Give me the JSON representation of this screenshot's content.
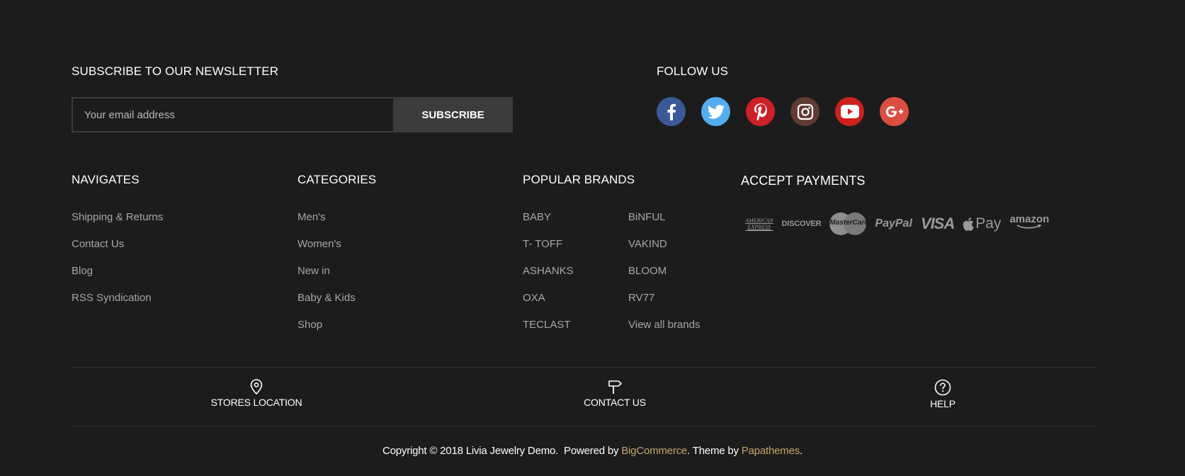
{
  "newsletter": {
    "heading": "SUBSCRIBE TO OUR NEWSLETTER",
    "placeholder": "Your email address",
    "button": "SUBSCRIBE"
  },
  "follow": {
    "heading": "FOLLOW US",
    "networks": [
      {
        "name": "facebook-icon",
        "color": "#3b5998"
      },
      {
        "name": "twitter-icon",
        "color": "#55acee"
      },
      {
        "name": "pinterest-icon",
        "color": "#cb2027"
      },
      {
        "name": "instagram-icon",
        "color": "#5f3b31"
      },
      {
        "name": "youtube-icon",
        "color": "#cd201f"
      },
      {
        "name": "google-plus-icon",
        "color": "#dc4e41"
      }
    ]
  },
  "navigates": {
    "heading": "NAVIGATES",
    "items": [
      "Shipping & Returns",
      "Contact Us",
      "Blog",
      "RSS Syndication"
    ]
  },
  "categories": {
    "heading": "CATEGORIES",
    "items": [
      "Men's",
      "Women's",
      "New in",
      "Baby & Kids",
      "Shop"
    ]
  },
  "brands": {
    "heading": "POPULAR BRANDS",
    "col1": [
      "BABY",
      "T- TOFF",
      "ASHANKS",
      "OXA",
      "TECLAST"
    ],
    "col2": [
      "BiNFUL",
      "VAKIND",
      "BLOOM",
      "RV77",
      "View all brands"
    ]
  },
  "payments": {
    "heading": "ACCEPT PAYMENTS",
    "methods": {
      "amex_line1": "AMERICAN",
      "amex_line2": "EXPRESS",
      "discover": "DISCOVER",
      "mastercard": "MasterCard",
      "paypal": "PayPal",
      "visa": "VISA",
      "applepay": "Pay",
      "amazon": "amazon"
    }
  },
  "bottom_nav": {
    "stores": "STORES LOCATION",
    "contact": "CONTACT US",
    "help": "HELP"
  },
  "copyright": {
    "prefix": "Copyright © 2018 Livia Jewelry Demo.  Powered by ",
    "bigcommerce": "BigCommerce",
    "middle": ". Theme by ",
    "papathemes": "Papathemes",
    "suffix": "."
  },
  "colors": {
    "background": "#1b1c1b",
    "link": "#a7a7a7",
    "accent": "#c9a46a"
  }
}
